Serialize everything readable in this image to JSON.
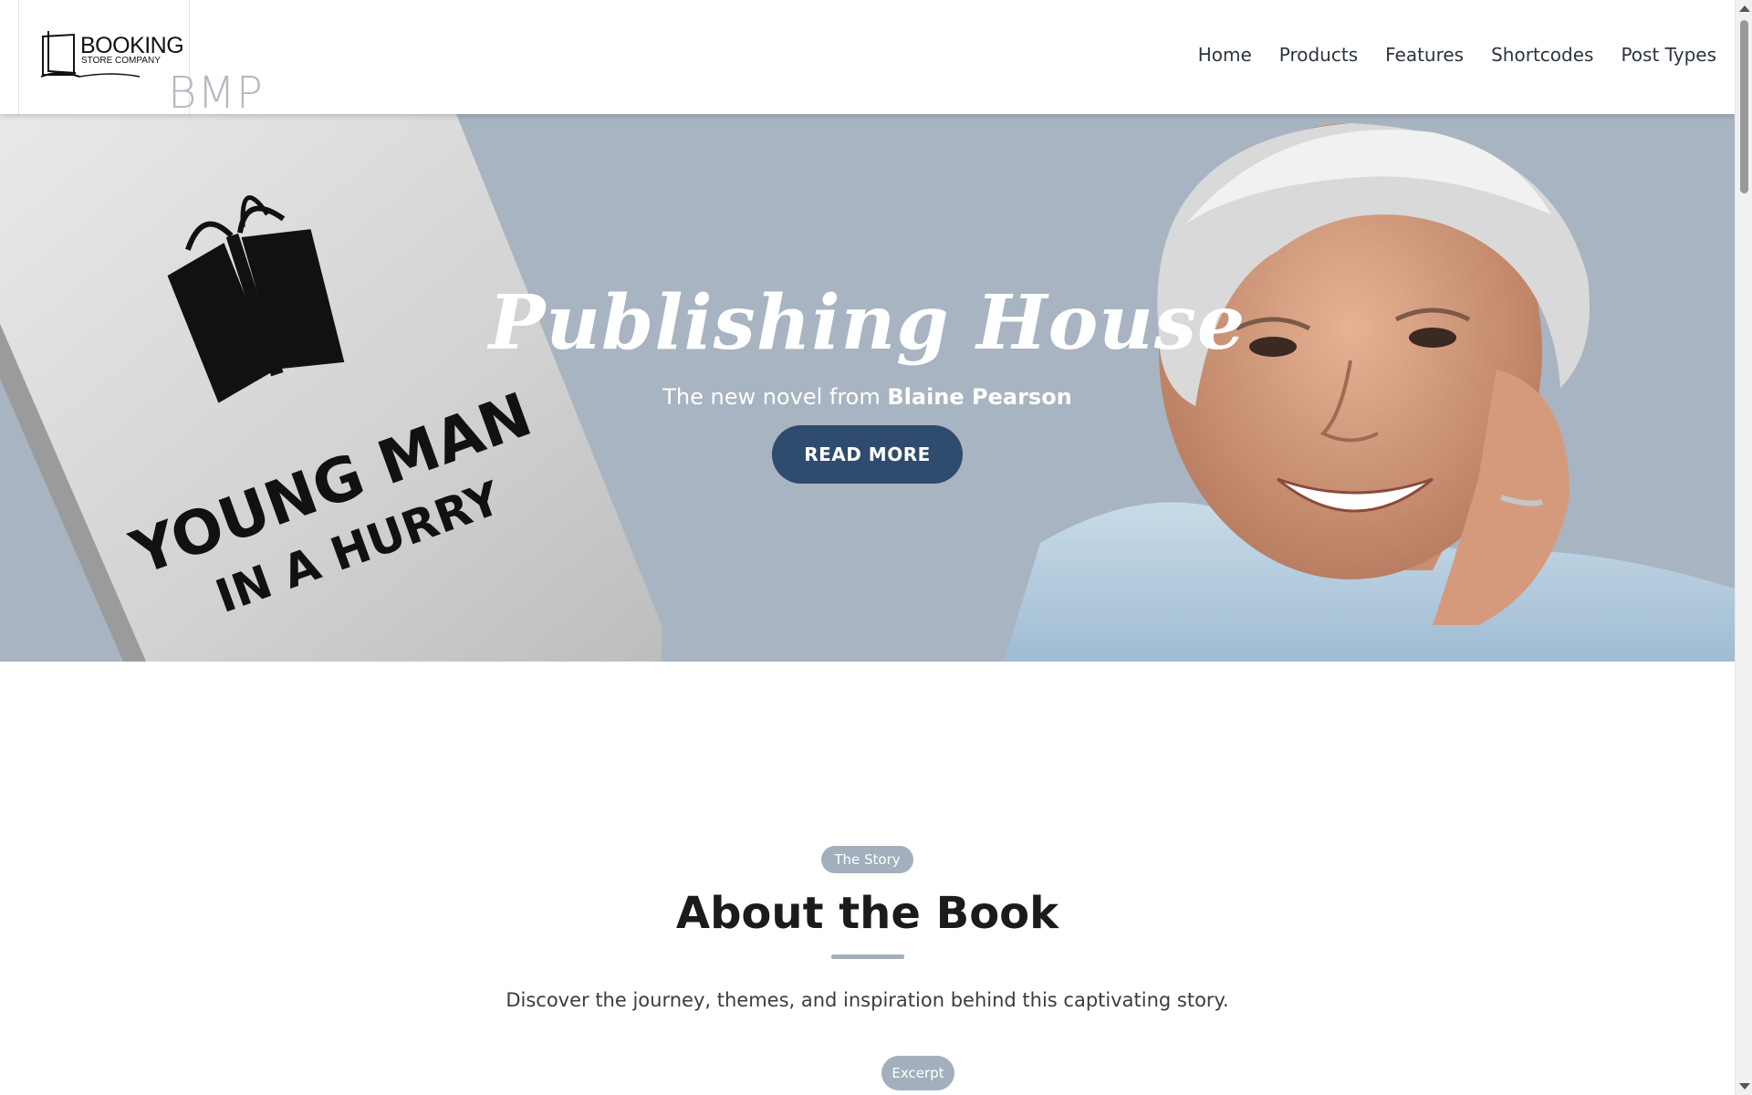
{
  "header": {
    "logo_title": "BOOKING",
    "logo_subtitle": "STORE COMPANY",
    "logo_mark_text": "BMP",
    "nav": [
      {
        "label": "Home"
      },
      {
        "label": "Products"
      },
      {
        "label": "Features"
      },
      {
        "label": "Shortcodes"
      },
      {
        "label": "Post Types"
      }
    ]
  },
  "hero": {
    "title": "Publishing House",
    "subtitle_prefix": "The new novel from ",
    "subtitle_author": "Blaine Pearson",
    "button_label": "READ MORE",
    "book_cover_text_line1": "YOUNG MAN",
    "book_cover_text_line2": "IN A HURRY",
    "background_color": "#a8b4c1",
    "button_color": "#2f4b6d"
  },
  "about": {
    "badge": "The Story",
    "title": "About the Book",
    "description": "Discover the journey, themes, and inspiration behind this captivating story.",
    "excerpt_badge": "Excerpt"
  }
}
